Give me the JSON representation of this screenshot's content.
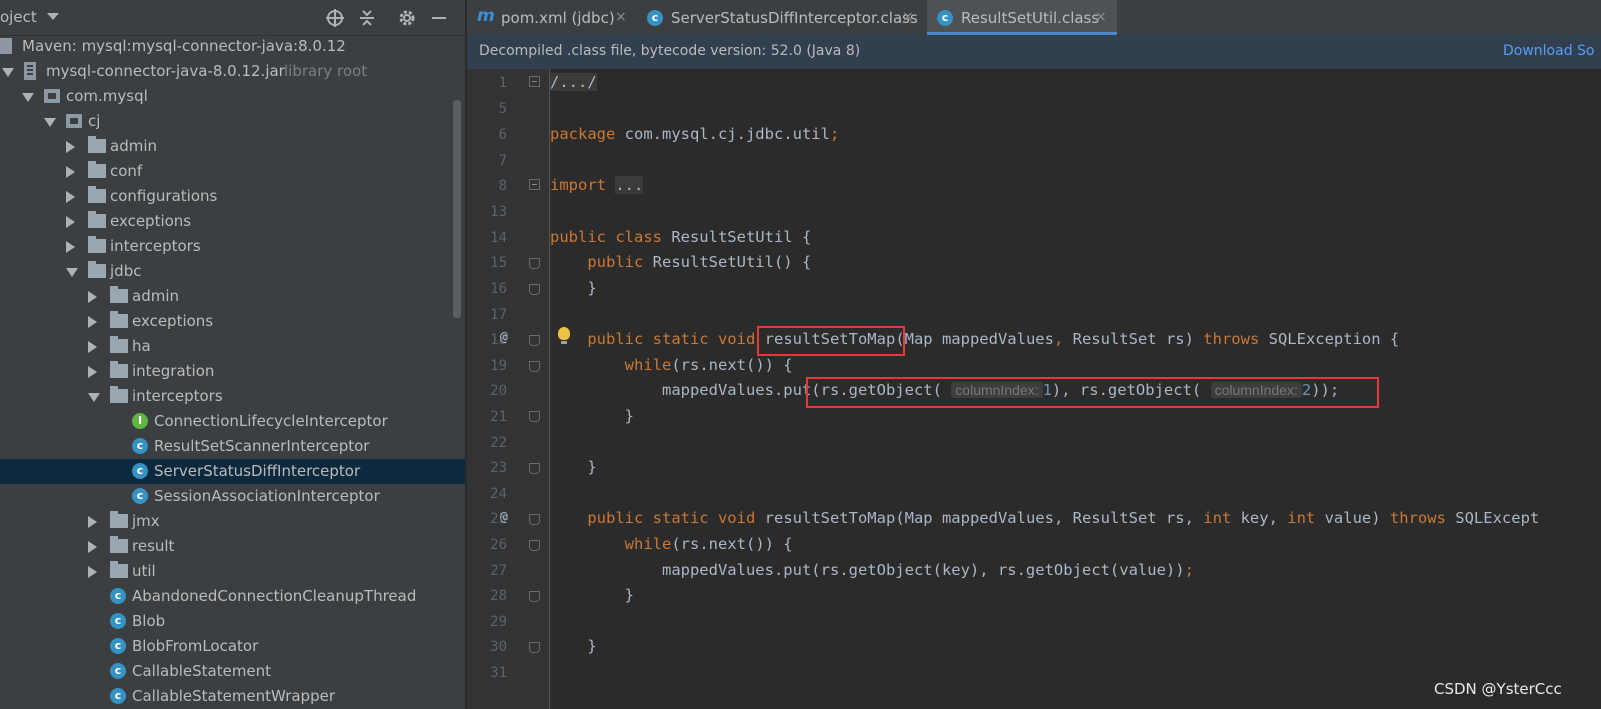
{
  "project_panel": {
    "title": "oject",
    "tree": [
      {
        "label": "Maven: mysql:mysql-connector-java:8.0.12",
        "icon": "maven-library-icon"
      },
      {
        "label": "mysql-connector-java-8.0.12.jar",
        "extra": "library root",
        "icon": "jar-icon"
      },
      {
        "label": "com.mysql",
        "icon": "package-icon"
      },
      {
        "label": "cj",
        "icon": "package-icon"
      },
      {
        "label": "admin",
        "icon": "folder-icon"
      },
      {
        "label": "conf",
        "icon": "folder-icon"
      },
      {
        "label": "configurations",
        "icon": "folder-icon"
      },
      {
        "label": "exceptions",
        "icon": "folder-icon"
      },
      {
        "label": "interceptors",
        "icon": "folder-icon"
      },
      {
        "label": "jdbc",
        "icon": "folder-icon"
      },
      {
        "label": "admin",
        "icon": "folder-icon"
      },
      {
        "label": "exceptions",
        "icon": "folder-icon"
      },
      {
        "label": "ha",
        "icon": "folder-icon"
      },
      {
        "label": "integration",
        "icon": "folder-icon"
      },
      {
        "label": "interceptors",
        "icon": "folder-icon"
      },
      {
        "label": "ConnectionLifecycleInterceptor",
        "icon": "interface-icon"
      },
      {
        "label": "ResultSetScannerInterceptor",
        "icon": "class-icon"
      },
      {
        "label": "ServerStatusDiffInterceptor",
        "icon": "class-icon",
        "selected": true
      },
      {
        "label": "SessionAssociationInterceptor",
        "icon": "class-icon"
      },
      {
        "label": "jmx",
        "icon": "folder-icon"
      },
      {
        "label": "result",
        "icon": "folder-icon"
      },
      {
        "label": "util",
        "icon": "folder-icon"
      },
      {
        "label": "AbandonedConnectionCleanupThread",
        "icon": "class-icon"
      },
      {
        "label": "Blob",
        "icon": "class-icon"
      },
      {
        "label": "BlobFromLocator",
        "icon": "class-icon"
      },
      {
        "label": "CallableStatement",
        "icon": "class-icon"
      },
      {
        "label": "CallableStatementWrapper",
        "icon": "class-icon"
      }
    ]
  },
  "tabs": [
    {
      "label": "pom.xml (jdbc)",
      "icon": "maven-m-icon"
    },
    {
      "label": "ServerStatusDiffInterceptor.class",
      "icon": "class-icon"
    },
    {
      "label": "ResultSetUtil.class",
      "icon": "class-icon",
      "active": true
    }
  ],
  "tab_icon_glyphs": {
    "maven": "m",
    "class": "c",
    "interface": "I",
    "close": "×"
  },
  "banner": {
    "text": "Decompiled .class file, bytecode version: 52.0 (Java 8)",
    "link": "Download So"
  },
  "editor": {
    "line_numbers": [
      "1",
      "5",
      "6",
      "7",
      "8",
      "13",
      "14",
      "15",
      "16",
      "17",
      "18",
      "19",
      "20",
      "21",
      "22",
      "23",
      "24",
      "25",
      "26",
      "27",
      "28",
      "29",
      "30",
      "31"
    ],
    "gutter_marks": {
      "line_18": "@",
      "line_25": "@"
    },
    "code": {
      "l1": "/.../",
      "l6_kw": "package",
      "l6_rest": " com.mysql.cj.jdbc.util",
      "l6_semi": ";",
      "l8_kw": "import",
      "l8_rest": "...",
      "l14_kw": "public class",
      "l14_rest": " ResultSetUtil {",
      "l15_kw": "public",
      "l15_rest": " ResultSetUtil() {",
      "l16": "}",
      "l18_kw": "public static void",
      "l18_fn": "resultSetToMap",
      "l18_rest1": "(Map mappedValues",
      "l18_comma": ",",
      "l18_rest2": " ResultSet rs) ",
      "l18_throws": "throws",
      "l18_rest3": " SQLException {",
      "l19_kw": "while",
      "l19_rest": "(rs.next()) {",
      "l20_a": "mappedValues.put(rs.getObject(",
      "l20_hint": "columnIndex:",
      "l20_n1": "1",
      "l20_b": "), rs.getObject(",
      "l20_n2": "2",
      "l20_c": "));",
      "l21": "}",
      "l23": "}",
      "l25_kw": "public static void",
      "l25_fn": "resultSetToMap",
      "l25_rest1": "(Map mappedValues, ResultSet rs, ",
      "l25_int1": "int",
      "l25_rest2": " key, ",
      "l25_int2": "int",
      "l25_rest3": " value) ",
      "l25_throws": "throws",
      "l25_rest4": " SQLExcept",
      "l26_kw": "while",
      "l26_rest": "(rs.next()) {",
      "l27": "mappedValues.put(rs.getObject(key), rs.getObject(value))",
      "l27_semi": ";",
      "l28": "}",
      "l30": "}"
    }
  },
  "watermark": "CSDN @YsterCcc",
  "colors": {
    "keyword": "#cc7832",
    "number": "#6897bb",
    "selection": "#0d293e",
    "highlight_box": "#e53935"
  }
}
